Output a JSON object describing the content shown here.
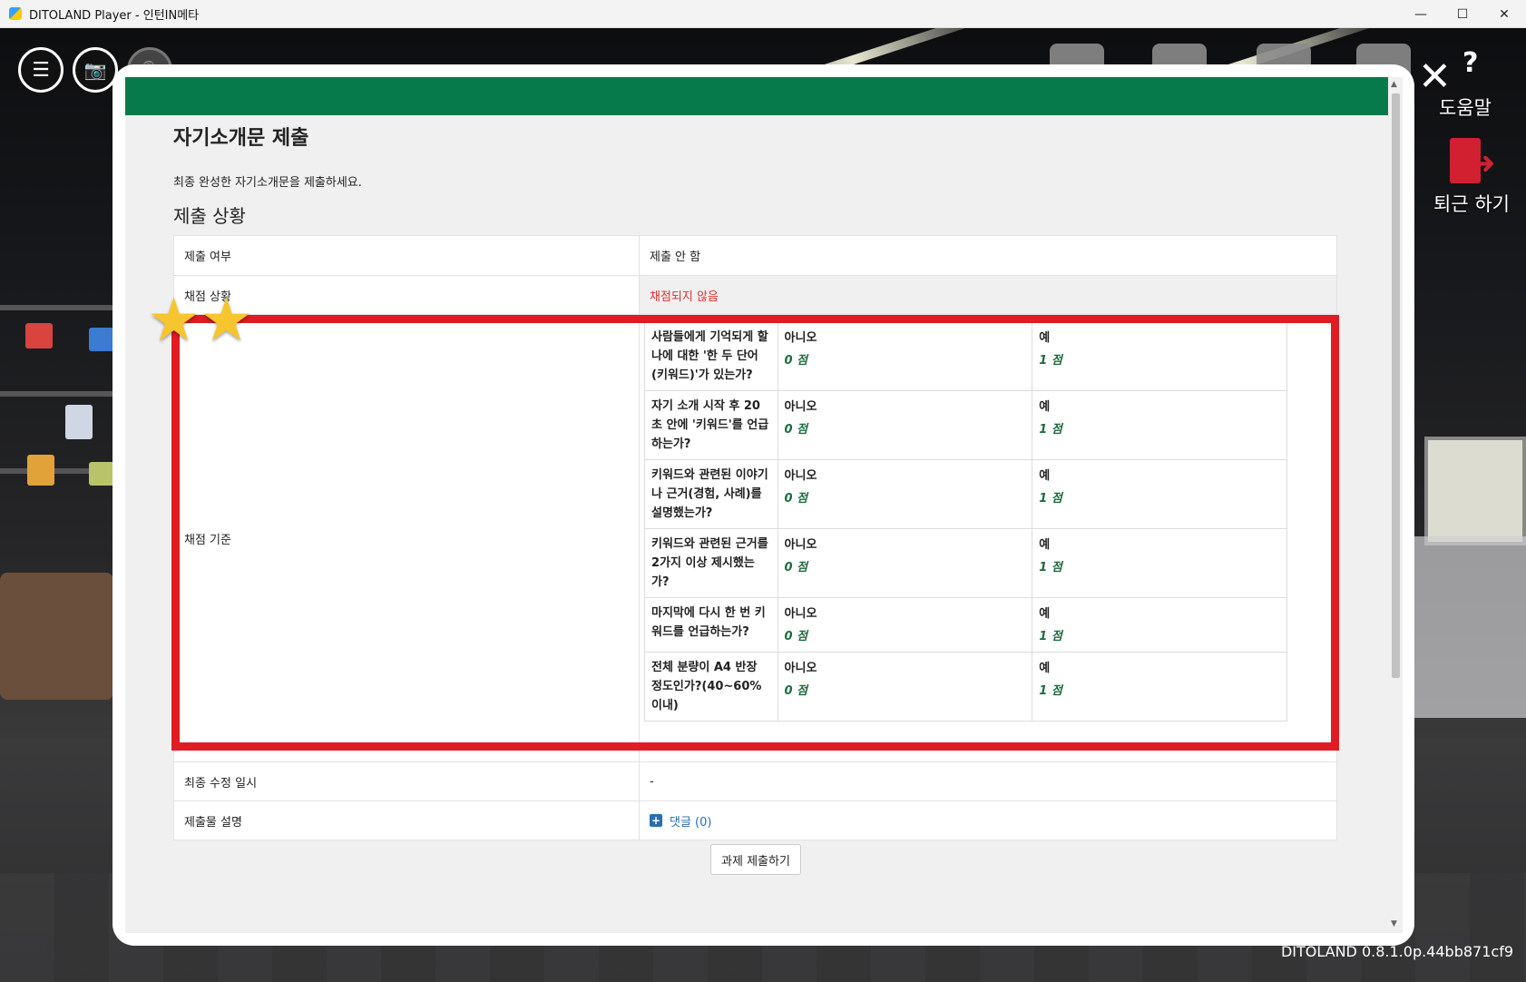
{
  "window": {
    "title": "DITOLAND Player - 인턴IN메타",
    "minimize": "—",
    "maximize": "☐",
    "close": "✕"
  },
  "hud": {
    "menu_icon": "☰",
    "camera_icon": "📷",
    "mic_icon": "🎙",
    "help_label": "도움말",
    "help_icon": "?",
    "exit_label": "퇴근 하기",
    "close_icon": "✕"
  },
  "page": {
    "title": "자기소개문 제출",
    "description": "최종 완성한 자기소개문을 제출하세요.",
    "section_title": "제출 상황"
  },
  "status": {
    "submitted_label": "제출 여부",
    "submitted_value": "제출 안 함",
    "grading_label": "채점 상황",
    "grading_value": "채점되지 않음",
    "criteria_label": "채점 기준",
    "modified_label": "최종 수정 일시",
    "modified_value": "-",
    "description_label": "제출물 설명",
    "comments_link": "댓글 (0)"
  },
  "criteria": [
    {
      "question": "사람들에게 기억되게 할 나에 대한 '한 두 단어(키워드)'가 있는가?",
      "no_label": "아니오",
      "no_score": "0 점",
      "yes_label": "예",
      "yes_score": "1 점"
    },
    {
      "question": "자기 소개 시작 후 20초 안에 '키워드'를 언급하는가?",
      "no_label": "아니오",
      "no_score": "0 점",
      "yes_label": "예",
      "yes_score": "1 점"
    },
    {
      "question": "키워드와 관련된 이야기나 근거(경험, 사례)를 설명했는가?",
      "no_label": "아니오",
      "no_score": "0 점",
      "yes_label": "예",
      "yes_score": "1 점"
    },
    {
      "question": "키워드와 관련된 근거를 2가지 이상 제시했는가?",
      "no_label": "아니오",
      "no_score": "0 점",
      "yes_label": "예",
      "yes_score": "1 점"
    },
    {
      "question": "마지막에 다시 한 번 키워드를 언급하는가?",
      "no_label": "아니오",
      "no_score": "0 점",
      "yes_label": "예",
      "yes_score": "1 점"
    },
    {
      "question": "전체 분량이 A4 반장 정도인가?(40~60% 이내)",
      "no_label": "아니오",
      "no_score": "0 점",
      "yes_label": "예",
      "yes_score": "1 점"
    }
  ],
  "actions": {
    "submit_button": "과제 제출하기"
  },
  "footer": {
    "version": "DITOLAND 0.8.1.0p.44bb871cf9"
  },
  "colors": {
    "header_green": "#077a4b",
    "annotation_red": "#e01b24",
    "ungraded_red": "#e03030",
    "score_green": "#1d6b3e",
    "link_blue": "#2a6db0"
  },
  "annotation": {
    "stars": "2"
  }
}
